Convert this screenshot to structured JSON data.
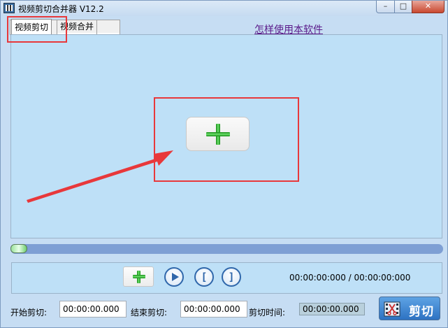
{
  "window": {
    "title": "视频剪切合并器 V12.2",
    "minimize_glyph": "–",
    "maximize_glyph": "□",
    "close_glyph": "✕"
  },
  "tabs": [
    {
      "label": "视频剪切",
      "active": true
    },
    {
      "label": "视频合并",
      "active": false
    }
  ],
  "help_link": "怎样使用本软件",
  "video_panel": {
    "add_button_icon": "plus-icon"
  },
  "progress": {
    "value": 0
  },
  "controls": {
    "add_icon": "plus-icon",
    "play_icon": "play-icon",
    "mark_in_glyph": "[",
    "mark_out_glyph": "]",
    "time_display": "00:00:00:000 / 00:00:00:000"
  },
  "bottom": {
    "start_label": "开始剪切:",
    "start_value": "00:00:00.000",
    "end_label": "结束剪切:",
    "end_value": "00:00:00.000",
    "duration_label": "剪切时间:",
    "duration_value": "00:00:00.000",
    "cut_button_label": "剪切",
    "cut_icon": "film-scissors-icon"
  },
  "colors": {
    "annotation_red": "#e8383b",
    "panel_bg": "#bee0f7",
    "accent_blue": "#2f67ab",
    "plus_green": "#1e9a1e"
  }
}
